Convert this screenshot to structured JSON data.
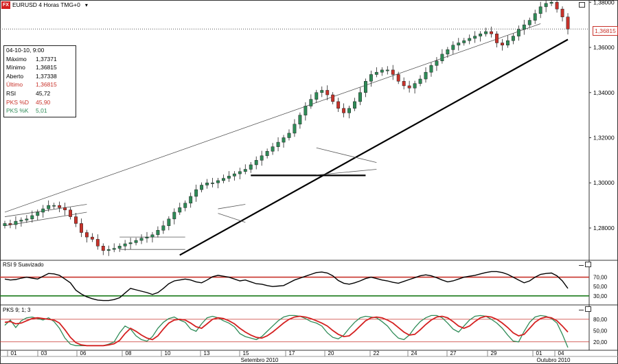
{
  "header": {
    "symbol_badge": "FX",
    "title": "EURUSD 4 Horas TMG+0",
    "dropdown_glyph": "▾"
  },
  "info_panel": {
    "date": "04-10-10, 9:00",
    "rows": [
      {
        "label": "Máximo",
        "value": "1,37371",
        "color": "#000000"
      },
      {
        "label": "Mínimo",
        "value": "1,36815",
        "color": "#000000"
      },
      {
        "label": "Aberto",
        "value": "1,37338",
        "color": "#000000"
      },
      {
        "label": "Último",
        "value": "1,36815",
        "color": "#c8322a"
      },
      {
        "label": "RSI",
        "value": "45,72",
        "color": "#000000"
      },
      {
        "label": "PKS %D",
        "value": "45,90",
        "color": "#c8322a"
      },
      {
        "label": "PKS %K",
        "value": "5,01",
        "color": "#2e8b57"
      }
    ]
  },
  "price_flag": "1,36815",
  "colors": {
    "candle_up": "#2e8b57",
    "candle_down": "#c8322a",
    "rsi_line": "#000000",
    "rsi_upper": "#c8322a",
    "rsi_lower": "#1a7a1a",
    "pks_d": "#d42020",
    "pks_k": "#2e8b57",
    "pks_levels": "#c8322a"
  },
  "chart_data": [
    {
      "type": "candlestick",
      "title": "EURUSD 4 Horas TMG+0",
      "ylim": [
        1.266,
        1.381
      ],
      "y_ticks": [
        "1,38000",
        "1,36000",
        "1,34000",
        "1,32000",
        "1,30000",
        "1,28000"
      ],
      "y_tick_values": [
        1.38,
        1.36,
        1.34,
        1.32,
        1.3,
        1.28
      ],
      "last_price": 1.36815,
      "close_series": [
        1.282,
        1.2815,
        1.283,
        1.2835,
        1.284,
        1.2855,
        1.287,
        1.2885,
        1.29,
        1.29,
        1.289,
        1.288,
        1.285,
        1.282,
        1.278,
        1.276,
        1.275,
        1.272,
        1.27,
        1.2705,
        1.271,
        1.272,
        1.273,
        1.2735,
        1.2745,
        1.2755,
        1.276,
        1.277,
        1.279,
        1.281,
        1.284,
        1.287,
        1.289,
        1.291,
        1.294,
        1.297,
        1.299,
        1.3,
        1.3,
        1.301,
        1.302,
        1.303,
        1.304,
        1.305,
        1.306,
        1.308,
        1.31,
        1.312,
        1.314,
        1.316,
        1.318,
        1.32,
        1.322,
        1.326,
        1.33,
        1.334,
        1.337,
        1.34,
        1.341,
        1.339,
        1.336,
        1.333,
        1.331,
        1.333,
        1.336,
        1.34,
        1.345,
        1.348,
        1.349,
        1.35,
        1.35,
        1.348,
        1.345,
        1.343,
        1.342,
        1.344,
        1.346,
        1.349,
        1.352,
        1.354,
        1.357,
        1.359,
        1.361,
        1.362,
        1.363,
        1.364,
        1.365,
        1.366,
        1.367,
        1.366,
        1.362,
        1.361,
        1.363,
        1.365,
        1.368,
        1.37,
        1.372,
        1.375,
        1.378,
        1.3795,
        1.38,
        1.377,
        1.3735,
        1.36815
      ],
      "overlays": [
        {
          "kind": "upper_trendline",
          "from": [
            0,
            1.287
          ],
          "to": [
            98,
            1.3705
          ]
        },
        {
          "kind": "lower_trendline",
          "from": [
            32,
            1.268
          ],
          "to": [
            103,
            1.3635
          ]
        },
        {
          "kind": "horizontal_support",
          "from": [
            45,
            1.3033
          ],
          "to": [
            66,
            1.3033
          ]
        },
        {
          "kind": "triangle_upper",
          "from": [
            57,
            1.3155
          ],
          "to": [
            68,
            1.309
          ]
        },
        {
          "kind": "triangle_lower",
          "from": [
            57,
            1.3035
          ],
          "to": [
            68,
            1.306
          ]
        },
        {
          "kind": "channel_upper",
          "from": [
            0,
            1.285
          ],
          "to": [
            15,
            1.2905
          ]
        },
        {
          "kind": "channel_lower",
          "from": [
            0,
            1.281
          ],
          "to": [
            15,
            1.287
          ]
        },
        {
          "kind": "range_top",
          "from": [
            21,
            1.276
          ],
          "to": [
            33,
            1.276
          ]
        },
        {
          "kind": "range_bottom",
          "from": [
            21,
            1.2705
          ],
          "to": [
            33,
            1.2705
          ]
        },
        {
          "kind": "flag_upper",
          "from": [
            39,
            1.2885
          ],
          "to": [
            44,
            1.2905
          ]
        },
        {
          "kind": "flag_lower",
          "from": [
            39,
            1.2865
          ],
          "to": [
            44,
            1.2825
          ]
        }
      ]
    },
    {
      "type": "line",
      "title": "RSI 9 Suavizado",
      "ylim": [
        15,
        90
      ],
      "y_ticks": [
        "70,00",
        "50,00",
        "30,00"
      ],
      "y_tick_values": [
        70,
        50,
        30
      ],
      "levels": [
        70,
        30
      ],
      "series": [
        {
          "name": "RSI 9 Suavizado",
          "values": [
            66,
            64,
            65,
            68,
            70,
            68,
            66,
            72,
            78,
            77,
            74,
            66,
            58,
            42,
            34,
            28,
            24,
            21,
            20,
            20,
            22,
            26,
            36,
            46,
            43,
            40,
            37,
            33,
            37,
            46,
            56,
            62,
            64,
            66,
            64,
            60,
            58,
            64,
            71,
            74,
            72,
            70,
            66,
            62,
            64,
            60,
            56,
            55,
            52,
            50,
            51,
            52,
            58,
            64,
            68,
            72,
            76,
            80,
            81,
            79,
            73,
            63,
            57,
            55,
            58,
            62,
            67,
            70,
            67,
            64,
            62,
            59,
            57,
            61,
            65,
            69,
            73,
            75,
            73,
            69,
            64,
            60,
            62,
            66,
            70,
            72,
            74,
            77,
            80,
            82,
            82,
            80,
            76,
            70,
            64,
            58,
            62,
            70,
            76,
            78,
            79,
            73,
            62,
            46
          ]
        }
      ]
    },
    {
      "type": "line",
      "title": "PKS 9; 1; 3",
      "ylim": [
        5,
        98
      ],
      "y_ticks": [
        "80,00",
        "50,00",
        "20,00"
      ],
      "y_tick_values": [
        80,
        50,
        20
      ],
      "levels": [
        80,
        20
      ],
      "series": [
        {
          "name": "PKS %D",
          "values": [
            72,
            74,
            68,
            70,
            76,
            82,
            84,
            82,
            80,
            78,
            70,
            52,
            32,
            18,
            12,
            10,
            10,
            10,
            10,
            12,
            15,
            24,
            42,
            56,
            48,
            38,
            30,
            26,
            36,
            54,
            70,
            78,
            80,
            78,
            70,
            60,
            56,
            68,
            80,
            84,
            82,
            76,
            68,
            56,
            46,
            38,
            32,
            30,
            36,
            46,
            58,
            70,
            80,
            86,
            88,
            86,
            82,
            76,
            70,
            62,
            50,
            40,
            34,
            36,
            48,
            62,
            76,
            84,
            86,
            84,
            78,
            70,
            58,
            46,
            38,
            40,
            52,
            66,
            78,
            86,
            88,
            84,
            74,
            62,
            56,
            62,
            74,
            84,
            88,
            86,
            80,
            70,
            58,
            44,
            36,
            40,
            56,
            72,
            82,
            86,
            84,
            76,
            62,
            46
          ]
        },
        {
          "name": "PKS %K",
          "values": [
            64,
            78,
            58,
            76,
            84,
            86,
            82,
            78,
            84,
            74,
            56,
            30,
            14,
            10,
            10,
            10,
            10,
            10,
            10,
            14,
            20,
            44,
            62,
            54,
            36,
            26,
            22,
            34,
            56,
            72,
            82,
            86,
            78,
            72,
            54,
            48,
            68,
            84,
            88,
            84,
            76,
            70,
            60,
            42,
            34,
            30,
            26,
            34,
            48,
            62,
            76,
            86,
            90,
            90,
            88,
            82,
            74,
            70,
            62,
            44,
            32,
            28,
            38,
            56,
            72,
            84,
            88,
            86,
            84,
            74,
            62,
            44,
            30,
            26,
            38,
            58,
            74,
            84,
            90,
            90,
            84,
            70,
            54,
            46,
            62,
            78,
            88,
            90,
            88,
            80,
            70,
            56,
            38,
            22,
            20,
            48,
            72,
            86,
            90,
            88,
            82,
            70,
            40,
            5
          ]
        }
      ]
    }
  ],
  "x_axis": {
    "day_ticks": [
      "01",
      "03",
      "06",
      "08",
      "10",
      "13",
      "15",
      "17",
      "20",
      "22",
      "24",
      "27",
      "29",
      "01",
      "04"
    ],
    "month_labels": [
      "Setembro 2010",
      "Outubro 2010"
    ]
  },
  "sub_panels": {
    "rsi_label": "RSI 9 Suavizado",
    "pks_label": "PKS 9; 1; 3"
  }
}
